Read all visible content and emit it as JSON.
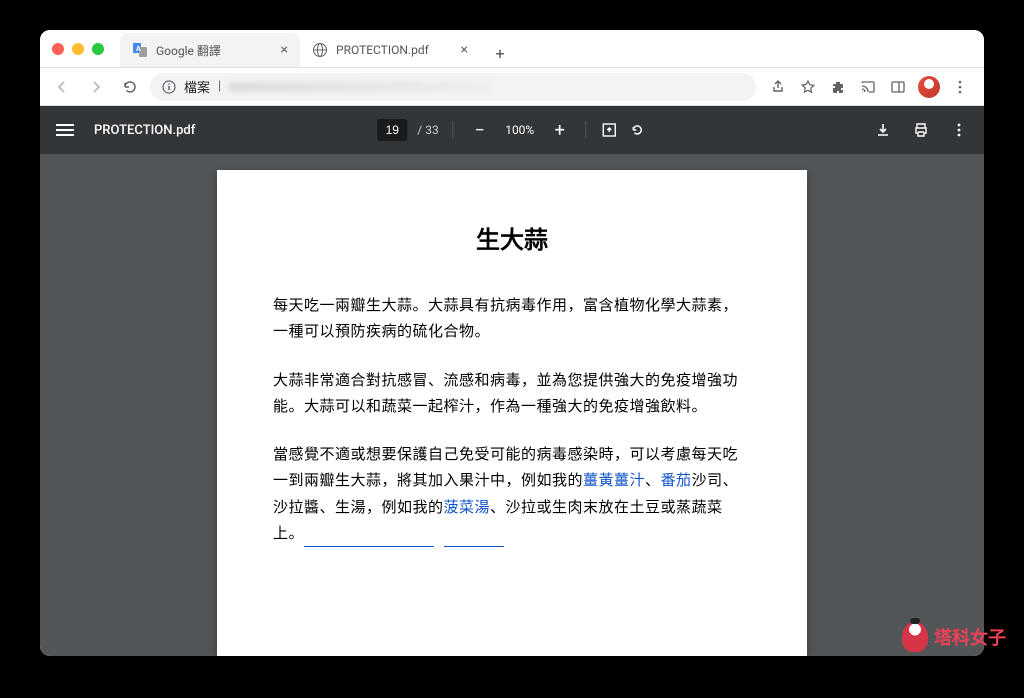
{
  "tabs": [
    {
      "title": "Google 翻譯",
      "active": false
    },
    {
      "title": "PROTECTION.pdf",
      "active": true
    }
  ],
  "url": {
    "scheme_label": "檔案"
  },
  "pdf": {
    "title": "PROTECTION.pdf",
    "page_current": "19",
    "page_total": "/ 33",
    "zoom": "100%"
  },
  "doc": {
    "heading": "生大蒜",
    "p1": "每天吃一兩瓣生大蒜。大蒜具有抗病毒作用，富含植物化學大蒜素，一種可以預防疾病的硫化合物。",
    "p2": "大蒜非常適合對抗感冒、流感和病毒，並為您提供強大的免疫增強功能。大蒜可以和蔬菜一起榨汁，作為一種強大的免疫增強飲料。",
    "p3a": "當感覺不適或想要保護自己免受可能的病毒感染時，可以考慮每天吃一到兩瓣生大蒜，將其加入果汁中，例如我的",
    "link1": "薑黃薑汁",
    "sep1": "、",
    "link2": "番茄",
    "p3b": "沙司、沙拉醬、生湯，例如我的",
    "link3": "菠菜湯",
    "p3c": "、沙拉或生肉末放在土豆或蒸蔬菜上。"
  },
  "watermark": "塔科女子"
}
